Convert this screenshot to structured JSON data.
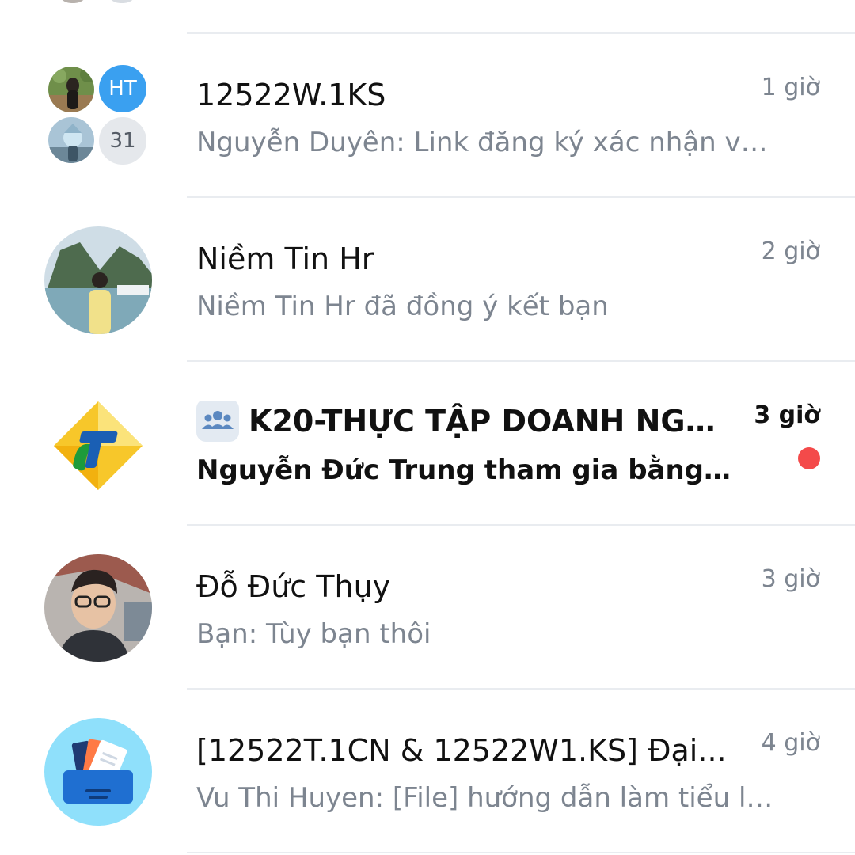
{
  "conversations": [
    {
      "title": "12522W.1KS",
      "preview": "Nguyễn Duyên: Link đăng ký xác nhận vay...",
      "time": "1 giờ",
      "group_initials": "HT",
      "member_count": "31"
    },
    {
      "title": "Niềm Tin Hr",
      "preview": "Niềm Tin Hr đã đồng ý kết bạn",
      "time": "2 giờ"
    },
    {
      "title": "K20-THỰC TẬP DOANH NGHI...",
      "preview": "Nguyễn Đức Trung tham gia bằng link...",
      "time": "3 giờ",
      "unread": true,
      "icon": "group-icon"
    },
    {
      "title": "Đỗ Đức Thụy",
      "preview": "Bạn: Tùy bạn thôi",
      "time": "3 giờ"
    },
    {
      "title": "[12522T.1CN & 12522W1.KS] Đại...",
      "preview": "Vu Thi Huyen: [File] hướng dẫn làm tiểu luận...",
      "time": "4 giờ",
      "icon": "folder-icon"
    }
  ],
  "colors": {
    "unread_dot": "#f44a4a",
    "ht_avatar": "#3aa0f0",
    "folder_bg": "#8fe0fb",
    "divider": "#e9ecf0"
  }
}
